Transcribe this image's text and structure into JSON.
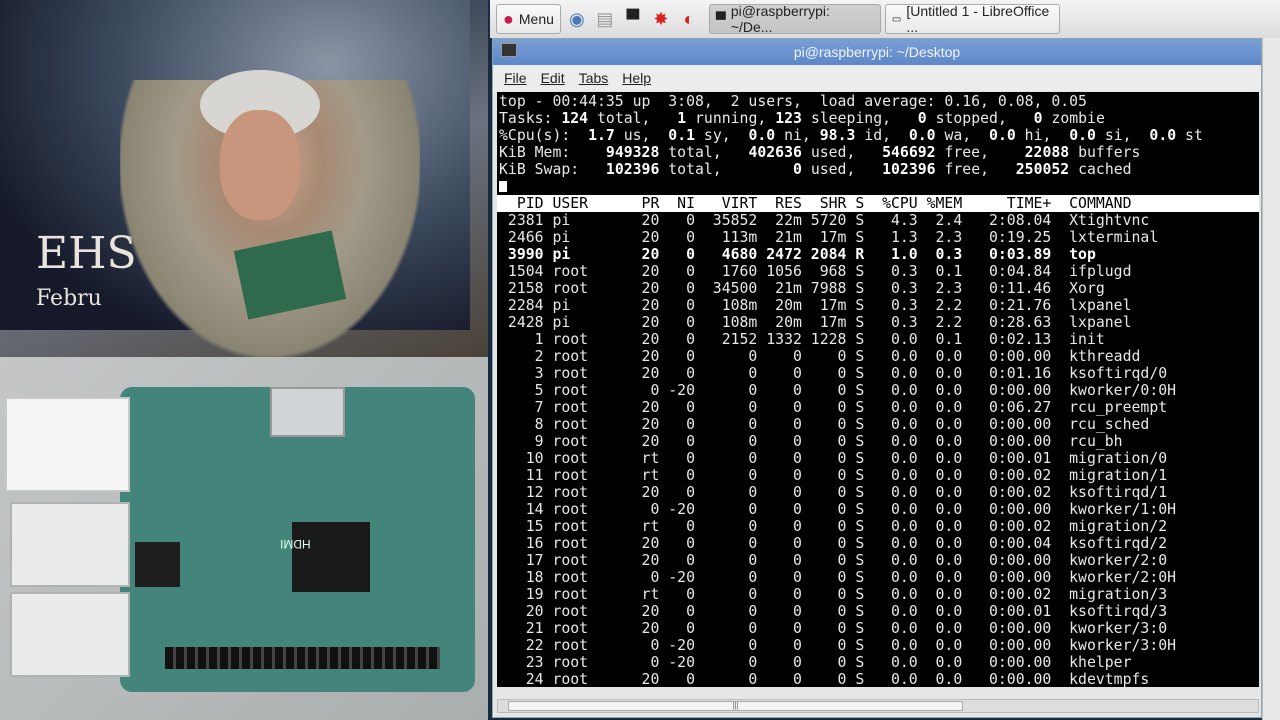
{
  "video": {
    "banner_text": "EHS",
    "banner_subtext": "Febru",
    "board_label": "HDMI"
  },
  "taskbar": {
    "menu_label": "Menu",
    "tasks": [
      {
        "label": "pi@raspberrypi: ~/De...",
        "active": true
      },
      {
        "label": "[Untitled 1 - LibreOffice ...",
        "active": false
      }
    ]
  },
  "window": {
    "title": "pi@raspberrypi: ~/Desktop",
    "menu": [
      "File",
      "Edit",
      "Tabs",
      "Help"
    ]
  },
  "top": {
    "summary": [
      "top - 00:44:35 up  3:08,  2 users,  load average: 0.16, 0.08, 0.05",
      "Tasks: 124 total,   1 running, 123 sleeping,   0 stopped,   0 zombie",
      "%Cpu(s):  1.7 us,  0.1 sy,  0.0 ni, 98.3 id,  0.0 wa,  0.0 hi,  0.0 si,  0.0 st",
      "KiB Mem:    949328 total,   402636 used,   546692 free,    22088 buffers",
      "KiB Swap:   102396 total,        0 used,   102396 free,   250052 cached"
    ],
    "columns": [
      "PID",
      "USER",
      "PR",
      "NI",
      "VIRT",
      "RES",
      "SHR",
      "S",
      "%CPU",
      "%MEM",
      "TIME+",
      "COMMAND"
    ],
    "processes": [
      [
        "2381",
        "pi",
        "20",
        "0",
        "35852",
        "22m",
        "5720",
        "S",
        "4.3",
        "2.4",
        "2:08.04",
        "Xtightvnc"
      ],
      [
        "2466",
        "pi",
        "20",
        "0",
        "113m",
        "21m",
        "17m",
        "S",
        "1.3",
        "2.3",
        "0:19.25",
        "lxterminal"
      ],
      [
        "3990",
        "pi",
        "20",
        "0",
        "4680",
        "2472",
        "2084",
        "R",
        "1.0",
        "0.3",
        "0:03.89",
        "top"
      ],
      [
        "1504",
        "root",
        "20",
        "0",
        "1760",
        "1056",
        "968",
        "S",
        "0.3",
        "0.1",
        "0:04.84",
        "ifplugd"
      ],
      [
        "2158",
        "root",
        "20",
        "0",
        "34500",
        "21m",
        "7988",
        "S",
        "0.3",
        "2.3",
        "0:11.46",
        "Xorg"
      ],
      [
        "2284",
        "pi",
        "20",
        "0",
        "108m",
        "20m",
        "17m",
        "S",
        "0.3",
        "2.2",
        "0:21.76",
        "lxpanel"
      ],
      [
        "2428",
        "pi",
        "20",
        "0",
        "108m",
        "20m",
        "17m",
        "S",
        "0.3",
        "2.2",
        "0:28.63",
        "lxpanel"
      ],
      [
        "1",
        "root",
        "20",
        "0",
        "2152",
        "1332",
        "1228",
        "S",
        "0.0",
        "0.1",
        "0:02.13",
        "init"
      ],
      [
        "2",
        "root",
        "20",
        "0",
        "0",
        "0",
        "0",
        "S",
        "0.0",
        "0.0",
        "0:00.00",
        "kthreadd"
      ],
      [
        "3",
        "root",
        "20",
        "0",
        "0",
        "0",
        "0",
        "S",
        "0.0",
        "0.0",
        "0:01.16",
        "ksoftirqd/0"
      ],
      [
        "5",
        "root",
        "0",
        "-20",
        "0",
        "0",
        "0",
        "S",
        "0.0",
        "0.0",
        "0:00.00",
        "kworker/0:0H"
      ],
      [
        "7",
        "root",
        "20",
        "0",
        "0",
        "0",
        "0",
        "S",
        "0.0",
        "0.0",
        "0:06.27",
        "rcu_preempt"
      ],
      [
        "8",
        "root",
        "20",
        "0",
        "0",
        "0",
        "0",
        "S",
        "0.0",
        "0.0",
        "0:00.00",
        "rcu_sched"
      ],
      [
        "9",
        "root",
        "20",
        "0",
        "0",
        "0",
        "0",
        "S",
        "0.0",
        "0.0",
        "0:00.00",
        "rcu_bh"
      ],
      [
        "10",
        "root",
        "rt",
        "0",
        "0",
        "0",
        "0",
        "S",
        "0.0",
        "0.0",
        "0:00.01",
        "migration/0"
      ],
      [
        "11",
        "root",
        "rt",
        "0",
        "0",
        "0",
        "0",
        "S",
        "0.0",
        "0.0",
        "0:00.02",
        "migration/1"
      ],
      [
        "12",
        "root",
        "20",
        "0",
        "0",
        "0",
        "0",
        "S",
        "0.0",
        "0.0",
        "0:00.02",
        "ksoftirqd/1"
      ],
      [
        "14",
        "root",
        "0",
        "-20",
        "0",
        "0",
        "0",
        "S",
        "0.0",
        "0.0",
        "0:00.00",
        "kworker/1:0H"
      ],
      [
        "15",
        "root",
        "rt",
        "0",
        "0",
        "0",
        "0",
        "S",
        "0.0",
        "0.0",
        "0:00.02",
        "migration/2"
      ],
      [
        "16",
        "root",
        "20",
        "0",
        "0",
        "0",
        "0",
        "S",
        "0.0",
        "0.0",
        "0:00.04",
        "ksoftirqd/2"
      ],
      [
        "17",
        "root",
        "20",
        "0",
        "0",
        "0",
        "0",
        "S",
        "0.0",
        "0.0",
        "0:00.00",
        "kworker/2:0"
      ],
      [
        "18",
        "root",
        "0",
        "-20",
        "0",
        "0",
        "0",
        "S",
        "0.0",
        "0.0",
        "0:00.00",
        "kworker/2:0H"
      ],
      [
        "19",
        "root",
        "rt",
        "0",
        "0",
        "0",
        "0",
        "S",
        "0.0",
        "0.0",
        "0:00.02",
        "migration/3"
      ],
      [
        "20",
        "root",
        "20",
        "0",
        "0",
        "0",
        "0",
        "S",
        "0.0",
        "0.0",
        "0:00.01",
        "ksoftirqd/3"
      ],
      [
        "21",
        "root",
        "20",
        "0",
        "0",
        "0",
        "0",
        "S",
        "0.0",
        "0.0",
        "0:00.00",
        "kworker/3:0"
      ],
      [
        "22",
        "root",
        "0",
        "-20",
        "0",
        "0",
        "0",
        "S",
        "0.0",
        "0.0",
        "0:00.00",
        "kworker/3:0H"
      ],
      [
        "23",
        "root",
        "0",
        "-20",
        "0",
        "0",
        "0",
        "S",
        "0.0",
        "0.0",
        "0:00.00",
        "khelper"
      ],
      [
        "24",
        "root",
        "20",
        "0",
        "0",
        "0",
        "0",
        "S",
        "0.0",
        "0.0",
        "0:00.00",
        "kdevtmpfs"
      ]
    ],
    "highlighted_pid": "3990"
  }
}
